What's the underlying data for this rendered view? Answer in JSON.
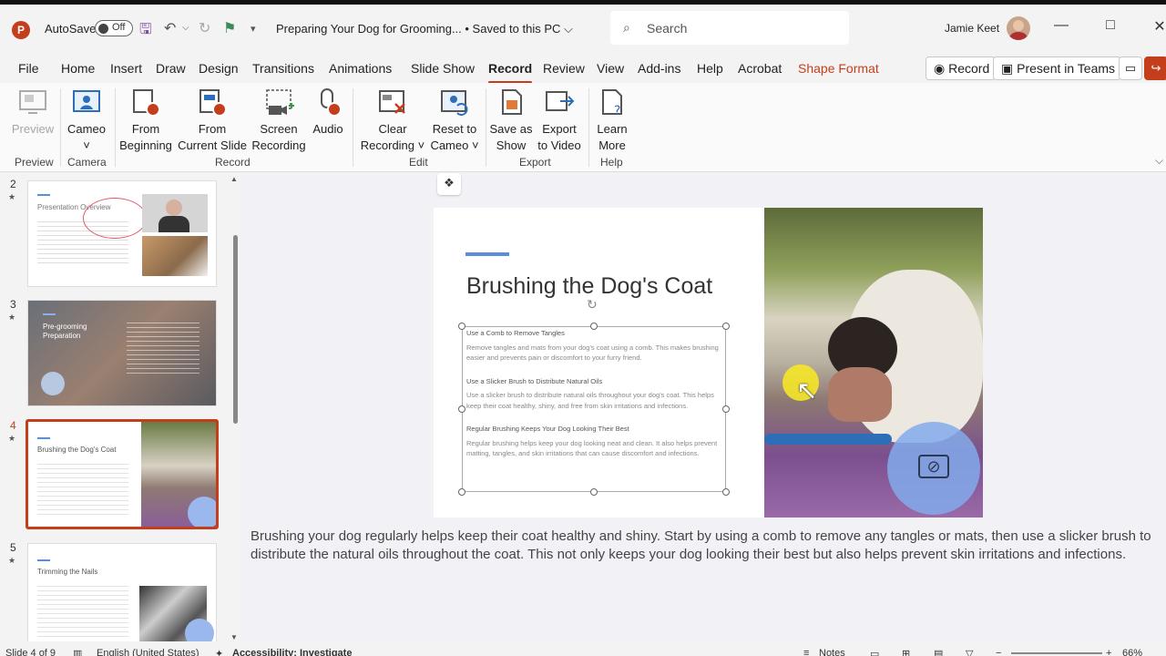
{
  "app": {
    "autosave_label": "AutoSave",
    "autosave_state": "Off",
    "document_title": "Preparing Your Dog for Grooming... • Saved to this PC ⌵",
    "search_placeholder": "Search",
    "user_name": "Jamie Keet"
  },
  "menu": {
    "tabs": [
      "File",
      "Home",
      "Insert",
      "Draw",
      "Design",
      "Transitions",
      "Animations",
      "Slide Show",
      "Record",
      "Review",
      "View",
      "Add-ins",
      "Help",
      "Acrobat",
      "Shape Format"
    ],
    "active_tab": "Record",
    "record_button": "Record",
    "present_teams": "Present in Teams"
  },
  "ribbon": {
    "buttons": [
      {
        "label1": "Preview",
        "label2": ""
      },
      {
        "label1": "Cameo",
        "label2": "˅"
      },
      {
        "label1": "From",
        "label2": "Beginning"
      },
      {
        "label1": "From",
        "label2": "Current Slide"
      },
      {
        "label1": "Screen",
        "label2": "Recording"
      },
      {
        "label1": "Audio",
        "label2": ""
      },
      {
        "label1": "Clear",
        "label2": "Recording ˅"
      },
      {
        "label1": "Reset to",
        "label2": "Cameo ˅"
      },
      {
        "label1": "Save as",
        "label2": "Show"
      },
      {
        "label1": "Export",
        "label2": "to Video"
      },
      {
        "label1": "Learn",
        "label2": "More"
      }
    ],
    "groups": [
      "Preview",
      "Camera",
      "Record",
      "Edit",
      "Export",
      "Help"
    ]
  },
  "thumbnails": {
    "slides": [
      {
        "number": "2",
        "title": "Presentation Overview"
      },
      {
        "number": "3",
        "title": "Pre-grooming Preparation"
      },
      {
        "number": "4",
        "title": "Brushing the Dog's Coat"
      },
      {
        "number": "5",
        "title": "Trimming the Nails"
      }
    ],
    "selected": "4"
  },
  "slide": {
    "title": "Brushing the Dog's Coat",
    "sections": [
      {
        "heading": "Use a Comb to Remove Tangles",
        "text": "Remove tangles and mats from your dog's coat using a comb. This makes brushing easier and prevents pain or discomfort to your furry friend."
      },
      {
        "heading": "Use a Slicker Brush to Distribute Natural Oils",
        "text": "Use a slicker brush to distribute natural oils throughout your dog's coat. This helps keep their coat healthy, shiny, and free from skin irritations and infections."
      },
      {
        "heading": "Regular Brushing Keeps Your Dog Looking Their Best",
        "text": "Regular brushing helps keep your dog looking neat and clean. It also helps prevent matting, tangles, and skin irritations that can cause discomfort and infections."
      }
    ]
  },
  "notes": "Brushing your dog regularly helps keep their coat healthy and shiny. Start by using a comb to remove any tangles or mats, then use a slicker brush to distribute the natural oils throughout the coat. This not only keeps your dog looking their best but also helps prevent skin irritations and infections.",
  "status": {
    "slide_count": "Slide 4 of 9",
    "language": "English (United States)",
    "accessibility": "Accessibility: Investigate",
    "notes_label": "Notes",
    "zoom": "66%"
  },
  "colors": {
    "accent": "#c43e1c",
    "slide_accent": "#5b8ed8"
  }
}
